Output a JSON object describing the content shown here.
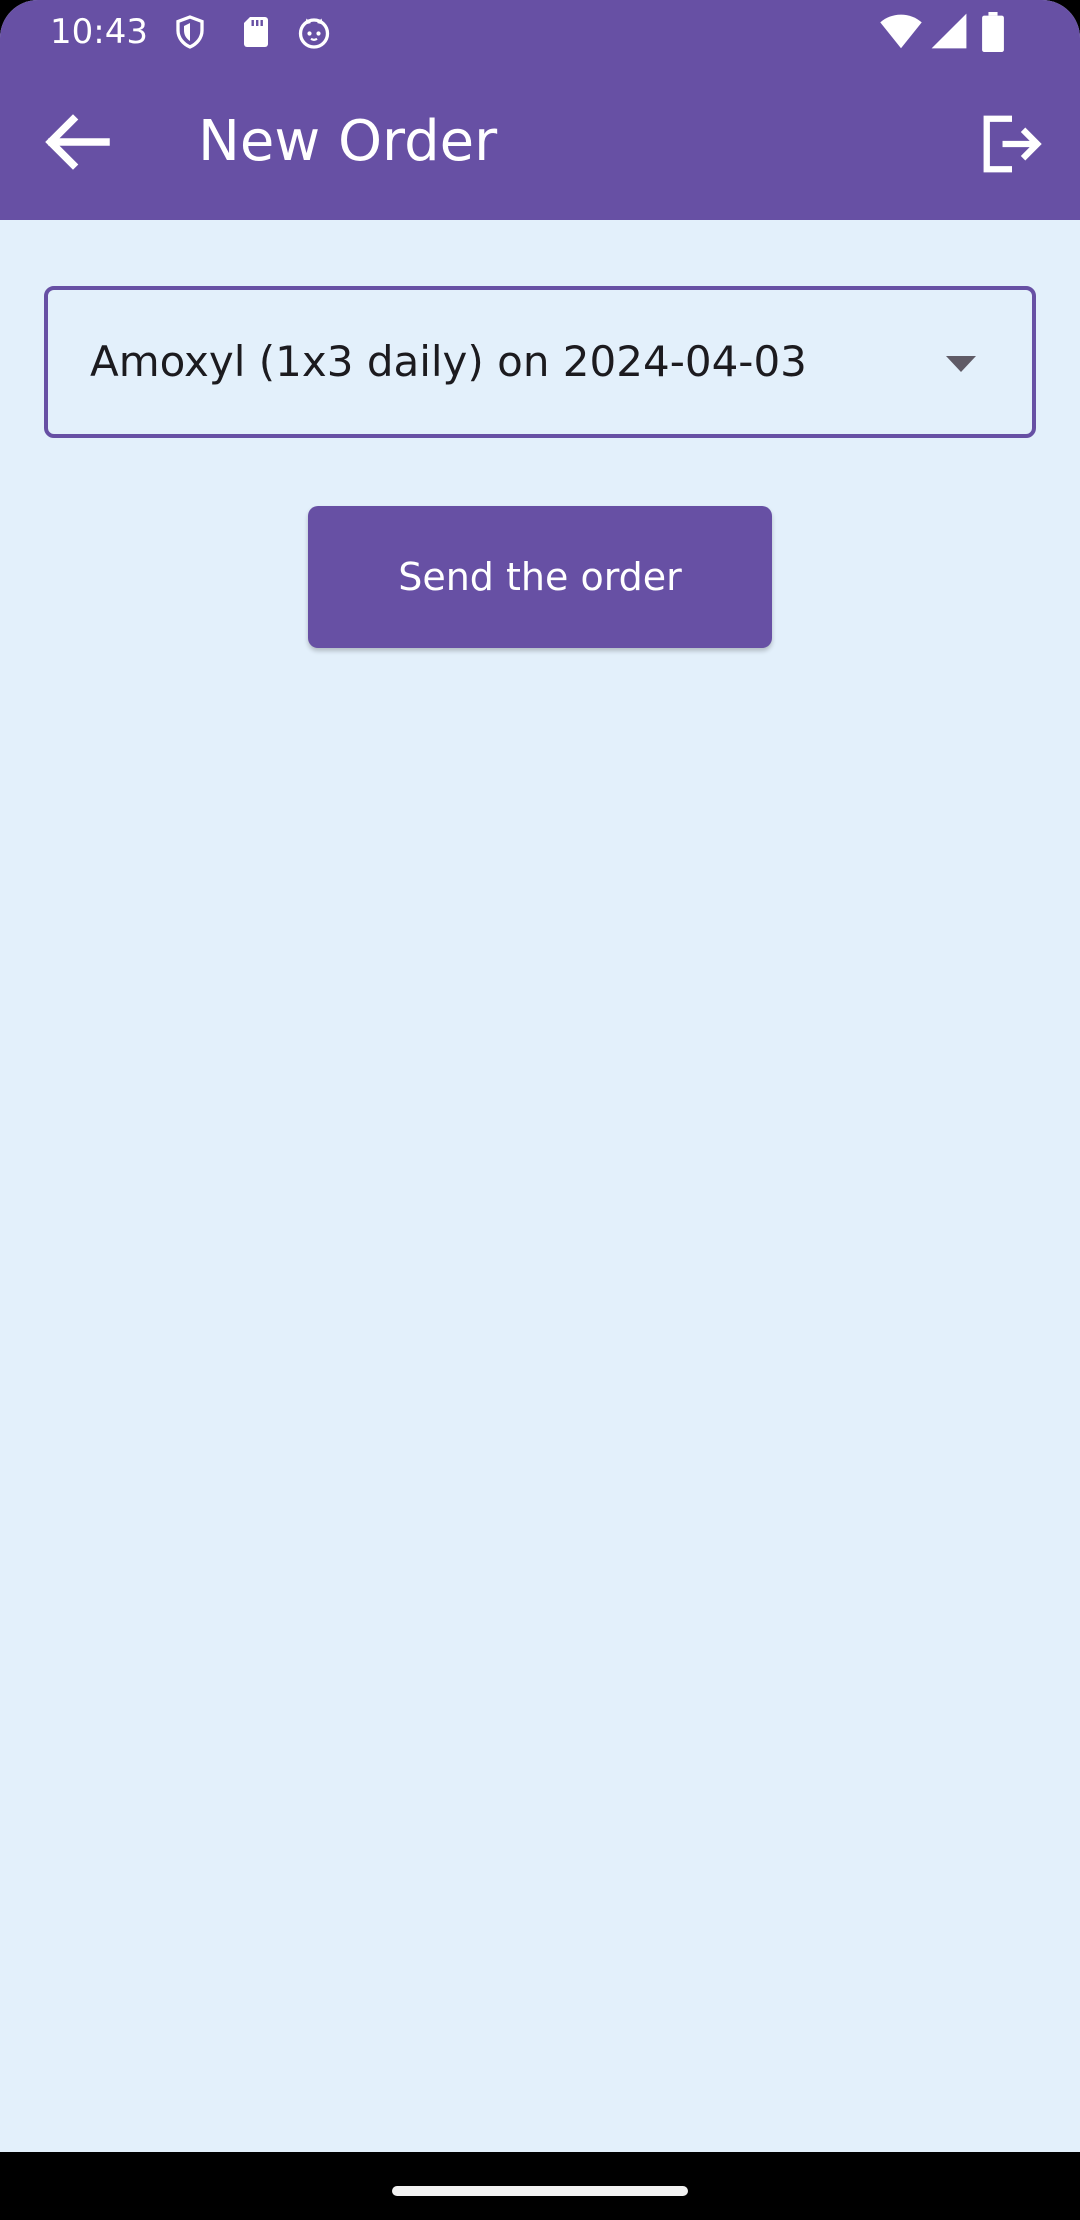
{
  "status_bar": {
    "time": "10:43",
    "icons_left": [
      "shield-icon",
      "sd-card-icon",
      "cat-face-icon"
    ],
    "icons_right": [
      "wifi-icon",
      "cellular-signal-icon",
      "battery-icon"
    ]
  },
  "app_bar": {
    "title": "New Order",
    "back_icon": "arrow-back-icon",
    "logout_icon": "logout-icon",
    "background": "#6750a4"
  },
  "order_form": {
    "selected_order": "Amoxyl (1x3 daily) on 2024-04-03",
    "dropdown_icon": "arrow-drop-down-icon",
    "send_label": "Send the order"
  },
  "colors": {
    "primary": "#6750a4",
    "background": "#e3f0fb",
    "on_primary": "#ffffff",
    "text": "#1c1b1f"
  }
}
